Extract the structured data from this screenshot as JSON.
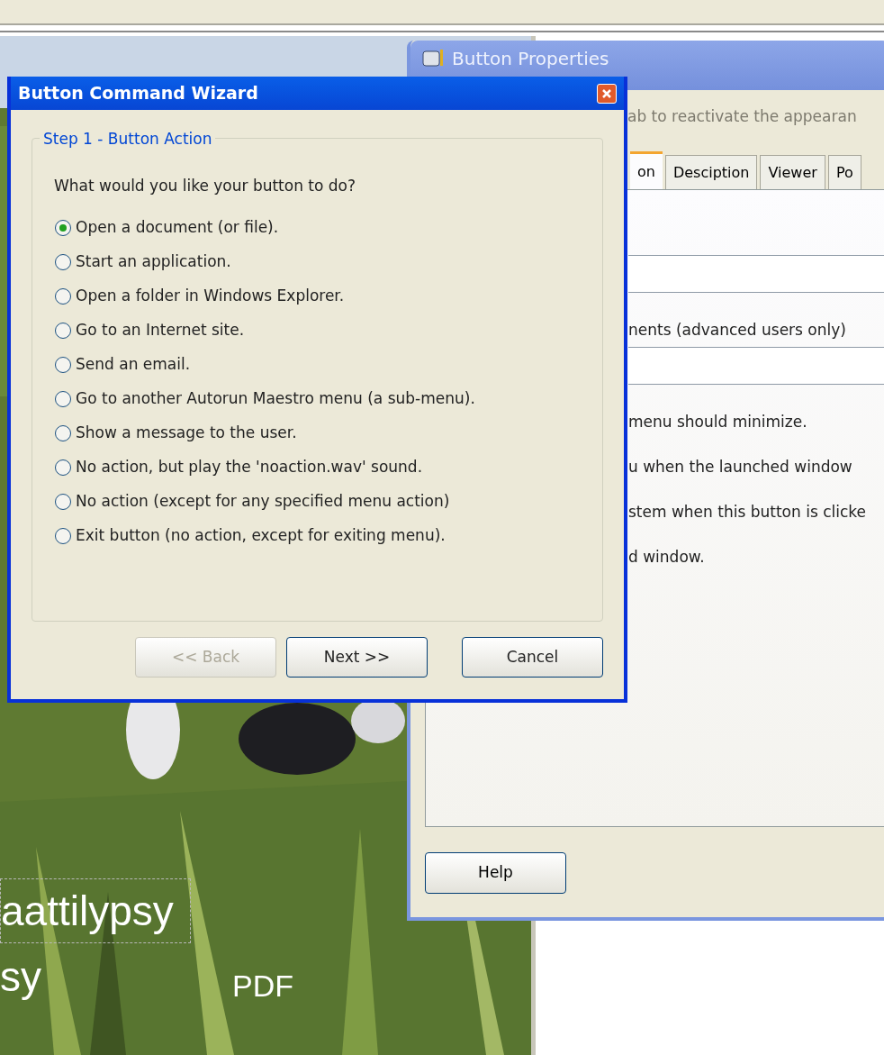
{
  "background_labels": [
    {
      "text": "aattilypsy",
      "boxed": true
    },
    {
      "text": "sy",
      "boxed": false
    },
    {
      "text": "PDF",
      "boxed": false
    }
  ],
  "properties_window": {
    "title": "Button Properties",
    "hint": "ab to reactivate the appearan",
    "tabs": [
      {
        "label": "on",
        "selected": true
      },
      {
        "label": "Desciption",
        "selected": false
      },
      {
        "label": "Viewer",
        "selected": false
      },
      {
        "label": "Po",
        "selected": false
      }
    ],
    "lines": [
      {
        "kind": "field"
      },
      {
        "kind": "text",
        "text": "nents (advanced users only)"
      },
      {
        "kind": "field"
      },
      {
        "kind": "text",
        "text": "menu should minimize."
      },
      {
        "kind": "text",
        "text": "u when the launched window"
      },
      {
        "kind": "text",
        "text": "stem when this button is clicke"
      },
      {
        "kind": "text",
        "text": "d window."
      }
    ],
    "help_button": "Help"
  },
  "wizard": {
    "title": "Button Command Wizard",
    "group": "Step 1 - Button Action",
    "question": "What would you like your button to do?",
    "options": [
      {
        "label": "Open a document (or file).",
        "selected": true
      },
      {
        "label": "Start an application.",
        "selected": false
      },
      {
        "label": "Open a folder in Windows Explorer.",
        "selected": false
      },
      {
        "label": "Go to an Internet site.",
        "selected": false
      },
      {
        "label": "Send an email.",
        "selected": false
      },
      {
        "label": "Go to another Autorun Maestro menu (a sub-menu).",
        "selected": false
      },
      {
        "label": "Show a message to the user.",
        "selected": false
      },
      {
        "label": "No action, but play the 'noaction.wav' sound.",
        "selected": false
      },
      {
        "label": "No action (except for any specified menu action)",
        "selected": false
      },
      {
        "label": "Exit button (no action, except for exiting menu).",
        "selected": false
      }
    ],
    "buttons": [
      {
        "label": "<< Back",
        "disabled": true
      },
      {
        "label": "Next >>",
        "disabled": false
      },
      {
        "label": "Cancel",
        "disabled": false
      }
    ]
  }
}
